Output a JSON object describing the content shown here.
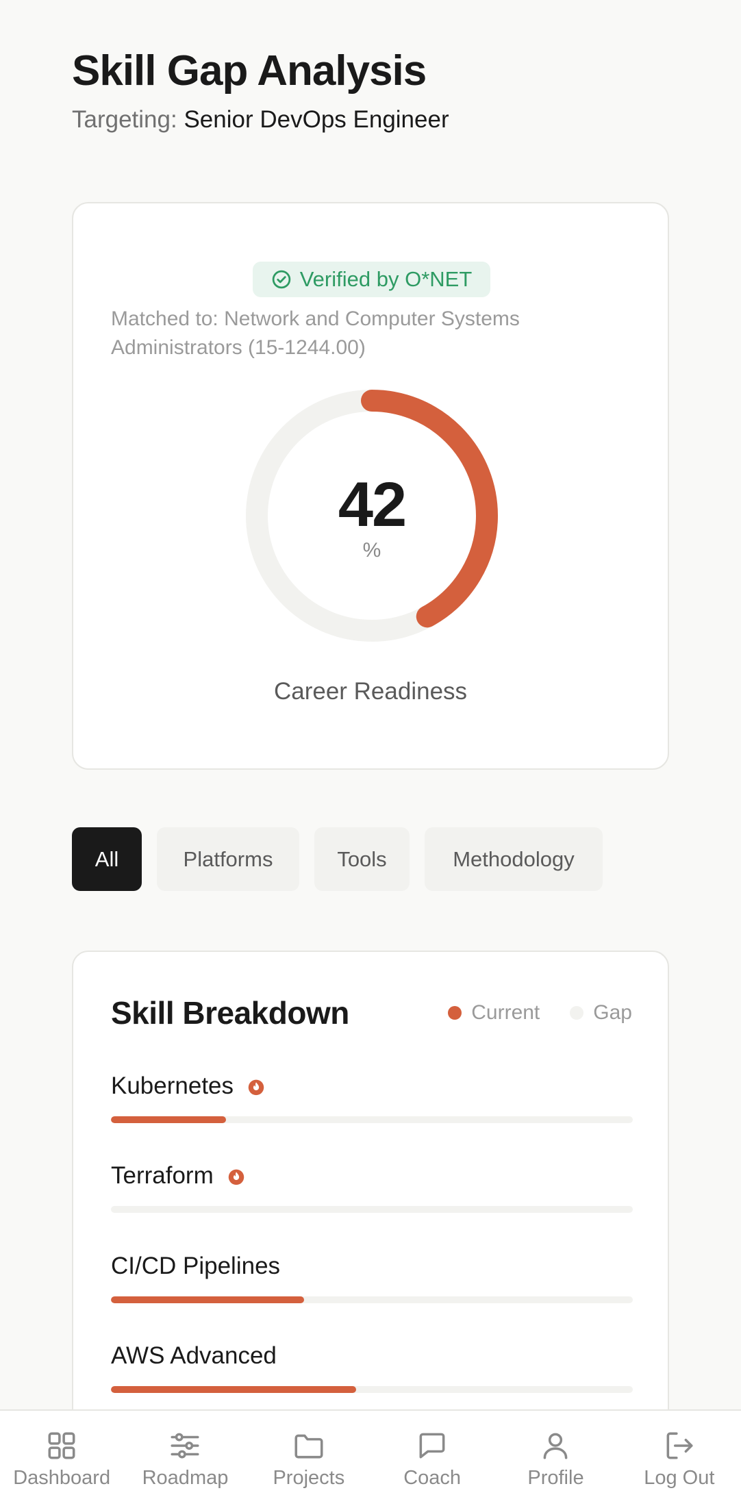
{
  "header": {
    "title": "Skill Gap Analysis",
    "targeting_label": "Targeting:",
    "targeting_value": "Senior DevOps Engineer"
  },
  "readiness": {
    "verified_badge": "Verified by O*NET",
    "matched_text": "Matched to: Network and Computer Systems Administrators (15-1244.00)",
    "value": "42",
    "value_fraction": 0.42,
    "unit": "%",
    "label": "Career Readiness"
  },
  "filters": {
    "all": "All",
    "platforms": "Platforms",
    "tools": "Tools",
    "methodology": "Methodology",
    "active": "All"
  },
  "breakdown": {
    "title": "Skill Breakdown",
    "legend_current": "Current",
    "legend_gap": "Gap",
    "skills": [
      {
        "name": "Kubernetes",
        "hot": true,
        "current_fraction": 0.22
      },
      {
        "name": "Terraform",
        "hot": true,
        "current_fraction": 0.0
      },
      {
        "name": "CI/CD Pipelines",
        "hot": false,
        "current_fraction": 0.37
      },
      {
        "name": "AWS Advanced",
        "hot": false,
        "current_fraction": 0.47
      }
    ]
  },
  "nav": {
    "dashboard": "Dashboard",
    "roadmap": "Roadmap",
    "projects": "Projects",
    "coach": "Coach",
    "profile": "Profile",
    "logout": "Log Out"
  },
  "colors": {
    "accent": "#d4603d",
    "verified_green": "#2e9b63",
    "track": "#f2f2ef"
  },
  "icons": {
    "verified": "check-circle-icon",
    "hot": "flame-icon",
    "dashboard": "grid-icon",
    "roadmap": "sliders-icon",
    "projects": "folder-icon",
    "coach": "chat-bubble-icon",
    "profile": "user-icon",
    "logout": "log-out-icon"
  }
}
